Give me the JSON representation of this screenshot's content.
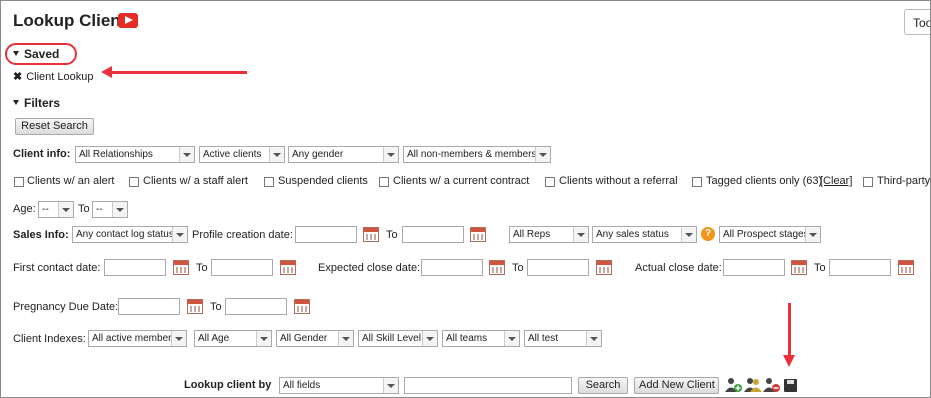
{
  "header": {
    "title": "Lookup Client",
    "tools_label": "Too"
  },
  "saved": {
    "heading": "Saved",
    "item": "Client Lookup"
  },
  "filters": {
    "heading": "Filters",
    "reset_label": "Reset Search"
  },
  "client_info": {
    "label": "Client info:",
    "relationship": "All Relationships",
    "status": "Active clients",
    "gender": "Any gender",
    "membership": "All non-members & members",
    "checkboxes": [
      "Clients w/ an alert",
      "Clients w/ a staff alert",
      "Suspended clients",
      "Clients w/ a current contract",
      "Clients without a referral",
      "Tagged clients only (63)",
      "Third-party"
    ],
    "clear_label": "[Clear]"
  },
  "age": {
    "label": "Age:",
    "from": "--",
    "to_label": "To",
    "to": "--"
  },
  "sales_info": {
    "label": "Sales Info:",
    "contact_log": "Any contact log status",
    "profile_label": "Profile creation date:",
    "to_label": "To",
    "reps": "All Reps",
    "sales_status": "Any sales status",
    "help_glyph": "?",
    "prospect_stages": "All Prospect stages"
  },
  "dates": {
    "first_contact": "First contact date:",
    "expected_close": "Expected close date:",
    "actual_close": "Actual close date:",
    "pregnancy_due": "Pregnancy Due Date:",
    "to_label": "To"
  },
  "indexes": {
    "label": "Client Indexes:",
    "options": [
      "All active members",
      "All Age",
      "All Gender",
      "All Skill Level",
      "All teams",
      "All test"
    ]
  },
  "lookup": {
    "label": "Lookup client by",
    "field": "All fields",
    "query": "",
    "search_label": "Search",
    "add_label": "Add New Client"
  },
  "colors": {
    "annotation": "#e8313a",
    "calendar": "#d0553f",
    "help": "#f0941c"
  }
}
